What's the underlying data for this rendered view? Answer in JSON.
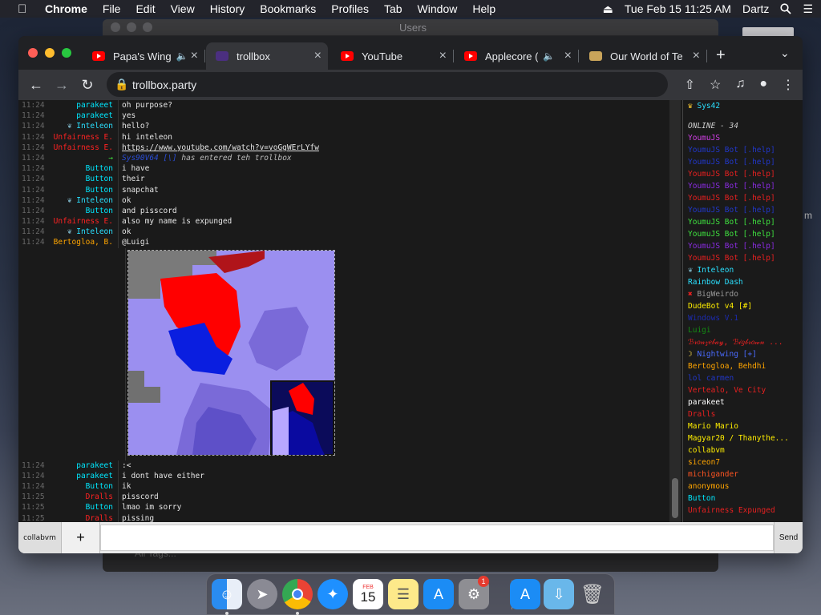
{
  "menubar": {
    "app_name": "Chrome",
    "items": [
      "File",
      "Edit",
      "View",
      "History",
      "Bookmarks",
      "Profiles",
      "Tab",
      "Window",
      "Help"
    ],
    "clock": "Tue Feb 15  11:25 AM",
    "user": "Dartz"
  },
  "background_window": {
    "title": "Users",
    "footer": "All Tags..."
  },
  "tabs": [
    {
      "title": "Papa's Wing",
      "favicon": "youtube-icon",
      "audio": true
    },
    {
      "title": "trollbox",
      "favicon": "trollbox-icon",
      "active": true
    },
    {
      "title": "YouTube",
      "favicon": "youtube-icon"
    },
    {
      "title": "Applecore (",
      "favicon": "youtube-icon",
      "audio": true
    },
    {
      "title": "Our World of Te",
      "favicon": "scroll-icon"
    }
  ],
  "url": "trollbox.party",
  "messages": [
    {
      "time": "11:24",
      "nick": "parakeet",
      "color": "#00e8ff",
      "text": "oh purpose?"
    },
    {
      "time": "11:24",
      "nick": "parakeet",
      "color": "#00e8ff",
      "text": "yes"
    },
    {
      "time": "11:24",
      "nick": "Inteleon",
      "color": "#2ae0ff",
      "icon": true,
      "text": "hello?"
    },
    {
      "time": "11:24",
      "nick": "Unfairness E.",
      "color": "#ff2222",
      "text": "hi inteleon"
    },
    {
      "time": "11:24",
      "nick": "Unfairness E.",
      "color": "#ff2222",
      "text": "https://www.youtube.com/watch?v=voGgWErLYfw",
      "link": true
    },
    {
      "time": "11:24",
      "nick": "→",
      "color": "#3fe23f",
      "system": true,
      "sys_nick": "Sys90V64 [\\]",
      "text": " has entered teh trollbox"
    },
    {
      "time": "11:24",
      "nick": "Button",
      "color": "#00e8ff",
      "text": "i have"
    },
    {
      "time": "11:24",
      "nick": "Button",
      "color": "#00e8ff",
      "text": "their"
    },
    {
      "time": "11:24",
      "nick": "Button",
      "color": "#00e8ff",
      "text": "snapchat"
    },
    {
      "time": "11:24",
      "nick": "Inteleon",
      "color": "#2ae0ff",
      "icon": true,
      "text": "ok"
    },
    {
      "time": "11:24",
      "nick": "Button",
      "color": "#00e8ff",
      "text": "and pisscord"
    },
    {
      "time": "11:24",
      "nick": "Unfairness E.",
      "color": "#ff2222",
      "text": "also my name is expunged"
    },
    {
      "time": "11:24",
      "nick": "Inteleon",
      "color": "#2ae0ff",
      "icon": true,
      "text": "ok"
    },
    {
      "time": "11:24",
      "nick": "Bertogloa, B.",
      "color": "#ffa500",
      "text": "@Luigi"
    }
  ],
  "messages_after": [
    {
      "time": "11:24",
      "nick": "parakeet",
      "color": "#00e8ff",
      "text": ":<"
    },
    {
      "time": "11:24",
      "nick": "parakeet",
      "color": "#00e8ff",
      "text": "i dont have either"
    },
    {
      "time": "11:24",
      "nick": "Button",
      "color": "#00e8ff",
      "text": "ik"
    },
    {
      "time": "11:25",
      "nick": "Dralls",
      "color": "#ff2222",
      "text": "pisscord"
    },
    {
      "time": "11:25",
      "nick": "Button",
      "color": "#00e8ff",
      "text": "lmao im sorry"
    },
    {
      "time": "11:25",
      "nick": "Dralls",
      "color": "#ff2222",
      "text": "pissing"
    }
  ],
  "userlist": {
    "top_user": "Sys42",
    "online_header": "ONLINE - 34",
    "users": [
      {
        "name": "YoumuJS",
        "color": "#d23fe6"
      },
      {
        "name": "YoumuJS Bot [.help]",
        "color": "#2137c9"
      },
      {
        "name": "YoumuJS Bot [.help]",
        "color": "#2137c9"
      },
      {
        "name": "YoumuJS Bot [.help]",
        "color": "#e82020"
      },
      {
        "name": "YoumuJS Bot [.help]",
        "color": "#8a2be2"
      },
      {
        "name": "YoumuJS Bot [.help]",
        "color": "#e82020"
      },
      {
        "name": "YoumuJS Bot [.help]",
        "color": "#2137c9"
      },
      {
        "name": "YoumuJS Bot [.help]",
        "color": "#3fe23f"
      },
      {
        "name": "YoumuJS Bot [.help]",
        "color": "#3fe23f"
      },
      {
        "name": "YoumuJS Bot [.help]",
        "color": "#8a2be2"
      },
      {
        "name": "YoumuJS Bot [.help]",
        "color": "#e82020"
      },
      {
        "name": "Inteleon",
        "color": "#2ae0ff",
        "icon": "pokemon-icon"
      },
      {
        "name": "Rainbow Dash",
        "color": "#2ae0ff"
      },
      {
        "name": "BigWeirdo",
        "color": "#9a9a9a",
        "icon": "x-icon"
      },
      {
        "name": "DudeBot v4 [#]",
        "color": "#ffee00"
      },
      {
        "name": "Windows V.1",
        "color": "#1c2bb0"
      },
      {
        "name": "Luigi",
        "color": "#138a13"
      },
      {
        "name": "ℬ𝓇𝑜𝓃𝓏𝑒𝒷𝒶𝓎, ℬ𝒾𝑔𝒷𝓇𝑜𝓌𝓃 ...",
        "color": "#e82020"
      },
      {
        "name": "Nightwing [+]",
        "color": "#4a6bff",
        "icon": "moon-icon"
      },
      {
        "name": "Bertogloa, Behdhi",
        "color": "#ffa500"
      },
      {
        "name": "lol carmen",
        "color": "#2137c9"
      },
      {
        "name": "Vertealo, Ve City",
        "color": "#e82020"
      },
      {
        "name": "parakeet",
        "color": "#ffffff"
      },
      {
        "name": "Dralls",
        "color": "#e82020"
      },
      {
        "name": "Mario Mario",
        "color": "#ffee00"
      },
      {
        "name": "Magyar20 / Thanythe...",
        "color": "#ffee00"
      },
      {
        "name": "collabvm",
        "color": "#ffee00"
      },
      {
        "name": "siceon7",
        "color": "#ffa500"
      },
      {
        "name": "michigander",
        "color": "#ff5522"
      },
      {
        "name": "anonymous",
        "color": "#ffa500"
      },
      {
        "name": "Button",
        "color": "#00e8ff"
      },
      {
        "name": "Unfairness Expunged",
        "color": "#e82020"
      }
    ]
  },
  "bottom": {
    "room": "collabvm",
    "plus": "+",
    "send": "Send",
    "input_value": ""
  },
  "dock": {
    "apps": [
      "finder-icon",
      "launchpad-icon",
      "chrome-icon",
      "safari-icon",
      "calendar-icon",
      "notes-icon",
      "app-store-icon",
      "system-preferences-icon",
      "app-store-folder-icon",
      "downloads-folder-icon",
      "trash-icon"
    ],
    "calendar_month": "FEB",
    "calendar_day": "15",
    "prefs_badge": "1"
  }
}
